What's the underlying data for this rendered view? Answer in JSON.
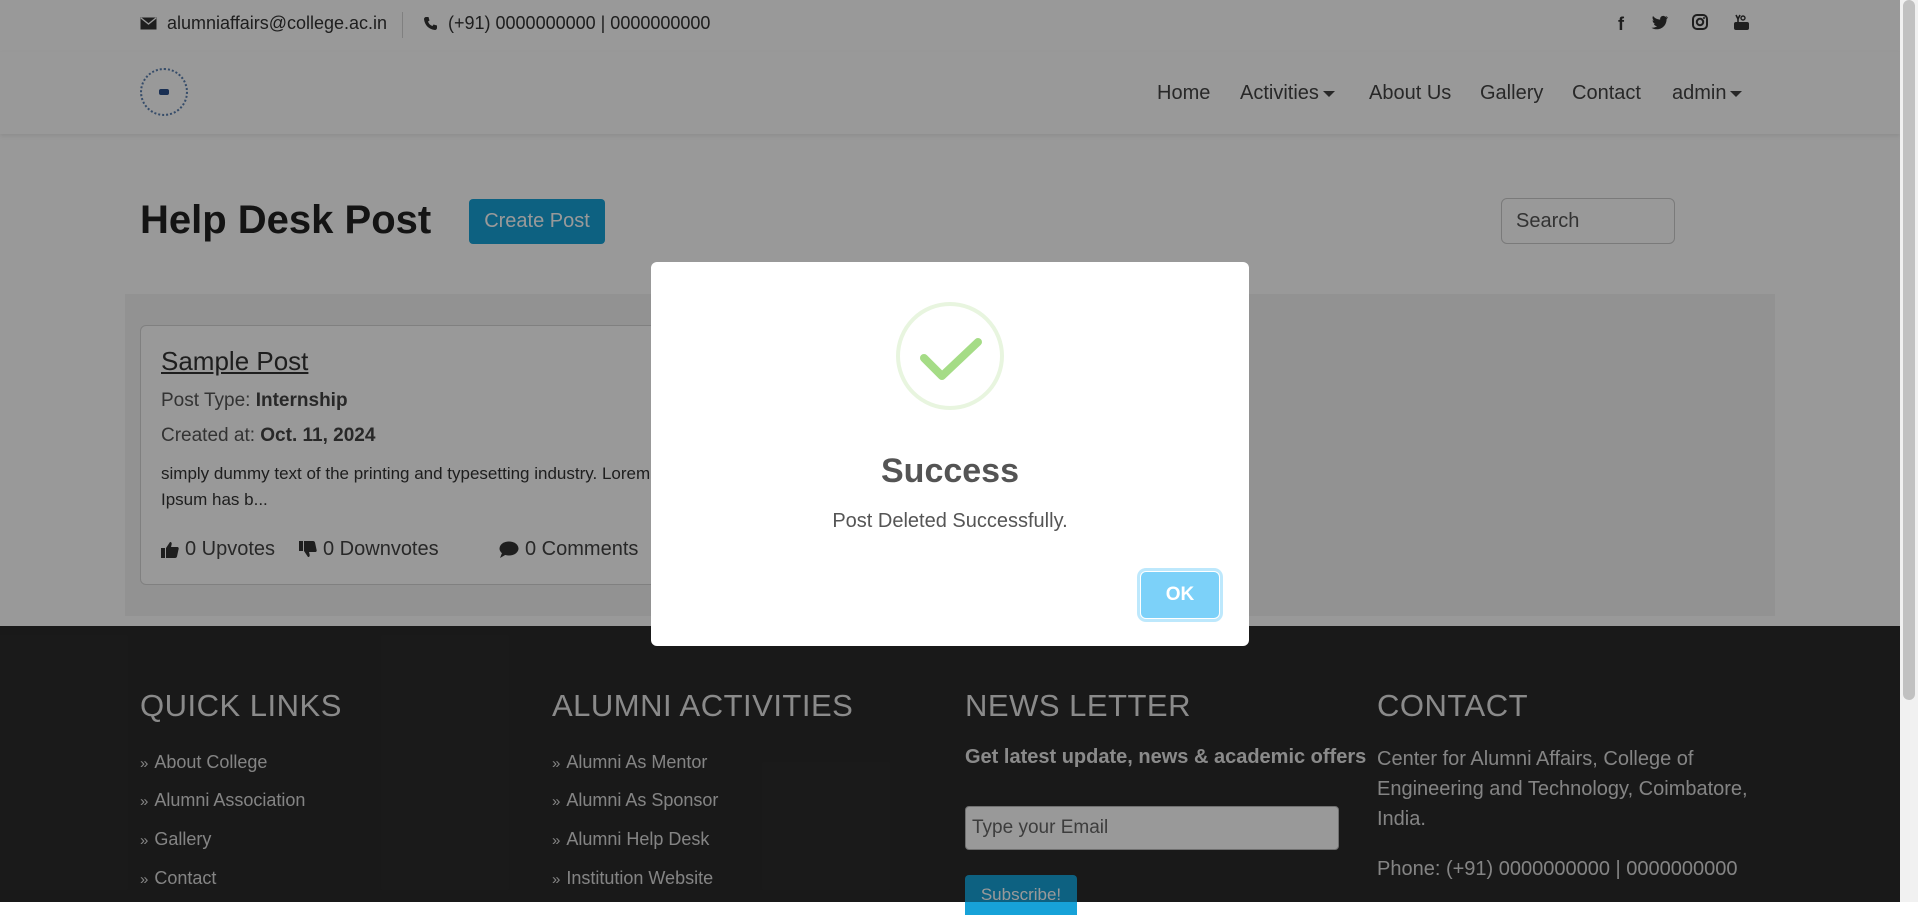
{
  "topbar": {
    "email": "alumniaffairs@college.ac.in",
    "phone": "(+91) 0000000000 | 0000000000",
    "social": {
      "facebook": "f",
      "twitter": "twitter-icon",
      "instagram": "instagram-icon",
      "youtube": "You"
    }
  },
  "nav": {
    "home": "Home",
    "activities": "Activities",
    "about": "About Us",
    "gallery": "Gallery",
    "contact": "Contact",
    "admin": "admin"
  },
  "main": {
    "title": "Help Desk Post",
    "create_button": "Create Post",
    "search_placeholder": "Search"
  },
  "post": {
    "title": "Sample Post",
    "type_label": "Post Type:",
    "type_value": "Internship",
    "created_label": "Created at:",
    "created_value": "Oct. 11, 2024",
    "description": "simply dummy text of the printing and typesetting industry. Lorem Ipsum has b...",
    "upvotes": "0 Upvotes",
    "downvotes": "0 Downvotes",
    "comments": "0 Comments"
  },
  "footer": {
    "quick_links": {
      "heading": "QUICK LINKS",
      "items": [
        "About College",
        "Alumni Association",
        "Gallery",
        "Contact"
      ]
    },
    "activities": {
      "heading": "ALUMNI ACTIVITIES",
      "items": [
        "Alumni As Mentor",
        "Alumni As Sponsor",
        "Alumni Help Desk",
        "Institution Website"
      ]
    },
    "newsletter": {
      "heading": "NEWS LETTER",
      "subheading": "Get latest update, news & academic offers",
      "email_placeholder": "Type your Email",
      "subscribe_label": "Subscribe!"
    },
    "contact": {
      "heading": "CONTACT",
      "address": "Center for Alumni Affairs, College of Engineering and Technology, Coimbatore, India.",
      "phone": "Phone: (+91) 0000000000 | 0000000000"
    }
  },
  "modal": {
    "title": "Success",
    "message": "Post Deleted Successfully.",
    "ok_label": "OK"
  },
  "colors": {
    "accent": "#17a2d8",
    "success_check": "#a5dc86",
    "footer_bg": "#2b2b2b",
    "ok_button": "#7cd1f9"
  }
}
